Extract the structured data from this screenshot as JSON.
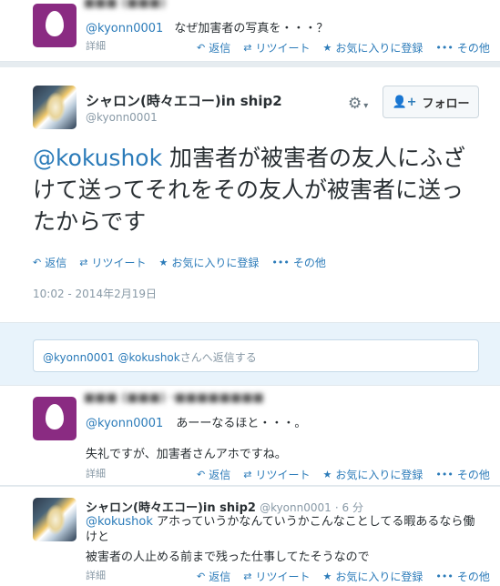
{
  "top_tweet": {
    "handle": "@kyonn0001",
    "text": "なぜ加害者の写真を・・・？",
    "details": "詳細",
    "actions": [
      "返信",
      "リツイート",
      "お気に入りに登録",
      "その他"
    ]
  },
  "main_tweet": {
    "display_name": "シャロン(時々エコー)in ship2",
    "handle": "@kyonn0001",
    "follow_label": "フォロー",
    "mention": "@kokushok",
    "text": " 加害者が被害者の友人にふざけて送ってそれをその友人が被害者に送ったからです",
    "actions": [
      "返信",
      "リツイート",
      "お気に入りに登録",
      "その他"
    ],
    "timestamp": "10:02 - 2014年2月19日"
  },
  "reply_box": {
    "placeholder_mentions": "@kyonn0001 @kokushok",
    "placeholder_suffix": "さんへ返信する"
  },
  "reply1": {
    "handle": "@kyonn0001",
    "line1": "あーーなるほと・・・。",
    "line2": "失礼ですが、加害者さんアホですね。",
    "details": "詳細",
    "actions": [
      "返信",
      "リツイート",
      "お気に入りに登録",
      "その他"
    ]
  },
  "reply2": {
    "display_name": "シャロン(時々エコー)in ship2",
    "handle": "@kyonn0001",
    "time": "· 6 分",
    "mention": "@kokushok",
    "line1": " アホっていうかなんていうかこんなことしてる暇あるなら働けと",
    "line2": "被害者の人止める前まで残った仕事してたそうなので",
    "details": "詳細",
    "actions": [
      "返信",
      "リツイート",
      "お気に入りに登録",
      "その他"
    ]
  },
  "colors": {
    "link": "#2b7bb9",
    "muted": "#8899a6",
    "egg": "#8a2b82",
    "background": "#e6ecf0"
  }
}
